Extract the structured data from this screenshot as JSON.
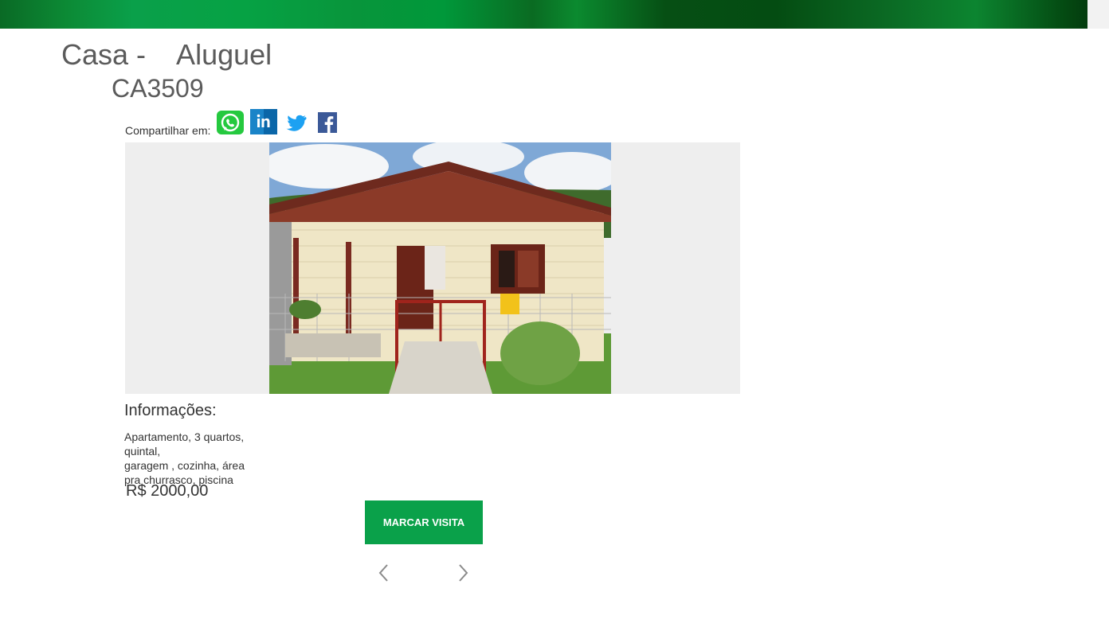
{
  "header": {
    "type_title": "Casa -    Aluguel",
    "code": "CA3509"
  },
  "share": {
    "label": "Compartilhar em:",
    "icons": [
      "whatsapp-icon",
      "linkedin-icon",
      "twitter-icon",
      "facebook-icon"
    ]
  },
  "info": {
    "title": "Informações:",
    "description": "Apartamento, 3 quartos, quintal,\ngaragem , cozinha, área pra churrasco, piscina",
    "price": "R$ 2000,00"
  },
  "actions": {
    "schedule_label": "MARCAR VISITA"
  },
  "colors": {
    "brand_green": "#0aa14a",
    "header_green": "#0a6a25"
  }
}
